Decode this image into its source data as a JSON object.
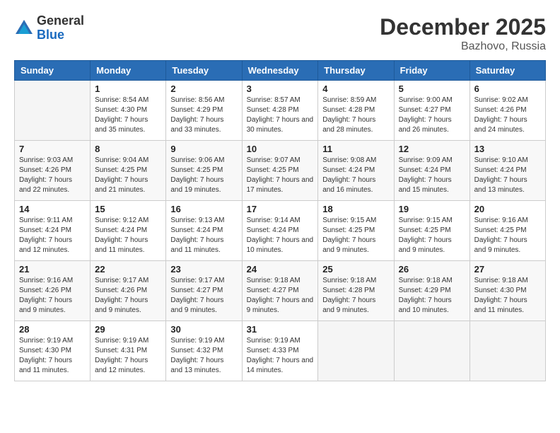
{
  "logo": {
    "general": "General",
    "blue": "Blue"
  },
  "header": {
    "month": "December 2025",
    "location": "Bazhovo, Russia"
  },
  "weekdays": [
    "Sunday",
    "Monday",
    "Tuesday",
    "Wednesday",
    "Thursday",
    "Friday",
    "Saturday"
  ],
  "weeks": [
    [
      {
        "day": "",
        "sunrise": "",
        "sunset": "",
        "daylight": ""
      },
      {
        "day": "1",
        "sunrise": "Sunrise: 8:54 AM",
        "sunset": "Sunset: 4:30 PM",
        "daylight": "Daylight: 7 hours and 35 minutes."
      },
      {
        "day": "2",
        "sunrise": "Sunrise: 8:56 AM",
        "sunset": "Sunset: 4:29 PM",
        "daylight": "Daylight: 7 hours and 33 minutes."
      },
      {
        "day": "3",
        "sunrise": "Sunrise: 8:57 AM",
        "sunset": "Sunset: 4:28 PM",
        "daylight": "Daylight: 7 hours and 30 minutes."
      },
      {
        "day": "4",
        "sunrise": "Sunrise: 8:59 AM",
        "sunset": "Sunset: 4:28 PM",
        "daylight": "Daylight: 7 hours and 28 minutes."
      },
      {
        "day": "5",
        "sunrise": "Sunrise: 9:00 AM",
        "sunset": "Sunset: 4:27 PM",
        "daylight": "Daylight: 7 hours and 26 minutes."
      },
      {
        "day": "6",
        "sunrise": "Sunrise: 9:02 AM",
        "sunset": "Sunset: 4:26 PM",
        "daylight": "Daylight: 7 hours and 24 minutes."
      }
    ],
    [
      {
        "day": "7",
        "sunrise": "Sunrise: 9:03 AM",
        "sunset": "Sunset: 4:26 PM",
        "daylight": "Daylight: 7 hours and 22 minutes."
      },
      {
        "day": "8",
        "sunrise": "Sunrise: 9:04 AM",
        "sunset": "Sunset: 4:25 PM",
        "daylight": "Daylight: 7 hours and 21 minutes."
      },
      {
        "day": "9",
        "sunrise": "Sunrise: 9:06 AM",
        "sunset": "Sunset: 4:25 PM",
        "daylight": "Daylight: 7 hours and 19 minutes."
      },
      {
        "day": "10",
        "sunrise": "Sunrise: 9:07 AM",
        "sunset": "Sunset: 4:25 PM",
        "daylight": "Daylight: 7 hours and 17 minutes."
      },
      {
        "day": "11",
        "sunrise": "Sunrise: 9:08 AM",
        "sunset": "Sunset: 4:24 PM",
        "daylight": "Daylight: 7 hours and 16 minutes."
      },
      {
        "day": "12",
        "sunrise": "Sunrise: 9:09 AM",
        "sunset": "Sunset: 4:24 PM",
        "daylight": "Daylight: 7 hours and 15 minutes."
      },
      {
        "day": "13",
        "sunrise": "Sunrise: 9:10 AM",
        "sunset": "Sunset: 4:24 PM",
        "daylight": "Daylight: 7 hours and 13 minutes."
      }
    ],
    [
      {
        "day": "14",
        "sunrise": "Sunrise: 9:11 AM",
        "sunset": "Sunset: 4:24 PM",
        "daylight": "Daylight: 7 hours and 12 minutes."
      },
      {
        "day": "15",
        "sunrise": "Sunrise: 9:12 AM",
        "sunset": "Sunset: 4:24 PM",
        "daylight": "Daylight: 7 hours and 11 minutes."
      },
      {
        "day": "16",
        "sunrise": "Sunrise: 9:13 AM",
        "sunset": "Sunset: 4:24 PM",
        "daylight": "Daylight: 7 hours and 11 minutes."
      },
      {
        "day": "17",
        "sunrise": "Sunrise: 9:14 AM",
        "sunset": "Sunset: 4:24 PM",
        "daylight": "Daylight: 7 hours and 10 minutes."
      },
      {
        "day": "18",
        "sunrise": "Sunrise: 9:15 AM",
        "sunset": "Sunset: 4:25 PM",
        "daylight": "Daylight: 7 hours and 9 minutes."
      },
      {
        "day": "19",
        "sunrise": "Sunrise: 9:15 AM",
        "sunset": "Sunset: 4:25 PM",
        "daylight": "Daylight: 7 hours and 9 minutes."
      },
      {
        "day": "20",
        "sunrise": "Sunrise: 9:16 AM",
        "sunset": "Sunset: 4:25 PM",
        "daylight": "Daylight: 7 hours and 9 minutes."
      }
    ],
    [
      {
        "day": "21",
        "sunrise": "Sunrise: 9:16 AM",
        "sunset": "Sunset: 4:26 PM",
        "daylight": "Daylight: 7 hours and 9 minutes."
      },
      {
        "day": "22",
        "sunrise": "Sunrise: 9:17 AM",
        "sunset": "Sunset: 4:26 PM",
        "daylight": "Daylight: 7 hours and 9 minutes."
      },
      {
        "day": "23",
        "sunrise": "Sunrise: 9:17 AM",
        "sunset": "Sunset: 4:27 PM",
        "daylight": "Daylight: 7 hours and 9 minutes."
      },
      {
        "day": "24",
        "sunrise": "Sunrise: 9:18 AM",
        "sunset": "Sunset: 4:27 PM",
        "daylight": "Daylight: 7 hours and 9 minutes."
      },
      {
        "day": "25",
        "sunrise": "Sunrise: 9:18 AM",
        "sunset": "Sunset: 4:28 PM",
        "daylight": "Daylight: 7 hours and 9 minutes."
      },
      {
        "day": "26",
        "sunrise": "Sunrise: 9:18 AM",
        "sunset": "Sunset: 4:29 PM",
        "daylight": "Daylight: 7 hours and 10 minutes."
      },
      {
        "day": "27",
        "sunrise": "Sunrise: 9:18 AM",
        "sunset": "Sunset: 4:30 PM",
        "daylight": "Daylight: 7 hours and 11 minutes."
      }
    ],
    [
      {
        "day": "28",
        "sunrise": "Sunrise: 9:19 AM",
        "sunset": "Sunset: 4:30 PM",
        "daylight": "Daylight: 7 hours and 11 minutes."
      },
      {
        "day": "29",
        "sunrise": "Sunrise: 9:19 AM",
        "sunset": "Sunset: 4:31 PM",
        "daylight": "Daylight: 7 hours and 12 minutes."
      },
      {
        "day": "30",
        "sunrise": "Sunrise: 9:19 AM",
        "sunset": "Sunset: 4:32 PM",
        "daylight": "Daylight: 7 hours and 13 minutes."
      },
      {
        "day": "31",
        "sunrise": "Sunrise: 9:19 AM",
        "sunset": "Sunset: 4:33 PM",
        "daylight": "Daylight: 7 hours and 14 minutes."
      },
      {
        "day": "",
        "sunrise": "",
        "sunset": "",
        "daylight": ""
      },
      {
        "day": "",
        "sunrise": "",
        "sunset": "",
        "daylight": ""
      },
      {
        "day": "",
        "sunrise": "",
        "sunset": "",
        "daylight": ""
      }
    ]
  ]
}
